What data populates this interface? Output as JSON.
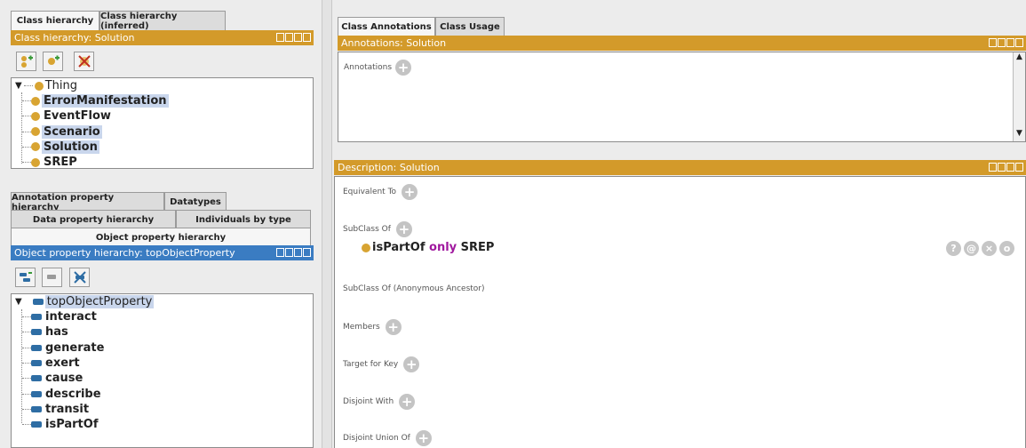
{
  "left_top": {
    "tabs": [
      "Class hierarchy",
      "Class hierarchy (inferred)"
    ],
    "panel_title": "Class hierarchy: Solution",
    "tree_root": "Thing",
    "classes": [
      {
        "label": "ErrorManifestation",
        "selected": true
      },
      {
        "label": "EventFlow",
        "selected": false
      },
      {
        "label": "Scenario",
        "selected": true
      },
      {
        "label": "Solution",
        "selected": true
      },
      {
        "label": "SREP",
        "selected": false
      }
    ]
  },
  "left_bottom": {
    "tabs_row1": [
      "Annotation property hierarchy",
      "Datatypes"
    ],
    "tabs_row2": [
      "Data property hierarchy",
      "Individuals by type"
    ],
    "tabs_row3": [
      "Object property hierarchy"
    ],
    "panel_title": "Object property hierarchy: topObjectProperty",
    "tree_root": "topObjectProperty",
    "properties": [
      "interact",
      "has",
      "generate",
      "exert",
      "cause",
      "describe",
      "transit",
      "isPartOf"
    ]
  },
  "right": {
    "tabs": [
      "Class Annotations",
      "Class Usage"
    ],
    "annotations_title": "Annotations: Solution",
    "annotations_label": "Annotations",
    "description_title": "Description: Solution",
    "sections": {
      "equivalent": "Equivalent To",
      "subclass": "SubClass Of",
      "subclass_anon": "SubClass Of (Anonymous Ancestor)",
      "members": "Members",
      "target": "Target for Key",
      "disjoint": "Disjoint With",
      "disjoint_union": "Disjoint Union Of"
    },
    "axiom": {
      "prop": "isPartOf",
      "keyword": "only",
      "filler": "SREP"
    },
    "axiom_buttons": [
      "?",
      "@",
      "×",
      "o"
    ]
  },
  "colors": {
    "orange": "#d39a2a",
    "blue": "#3a7cc2",
    "selection": "#c9d6ec",
    "keyword": "#a0189e"
  }
}
